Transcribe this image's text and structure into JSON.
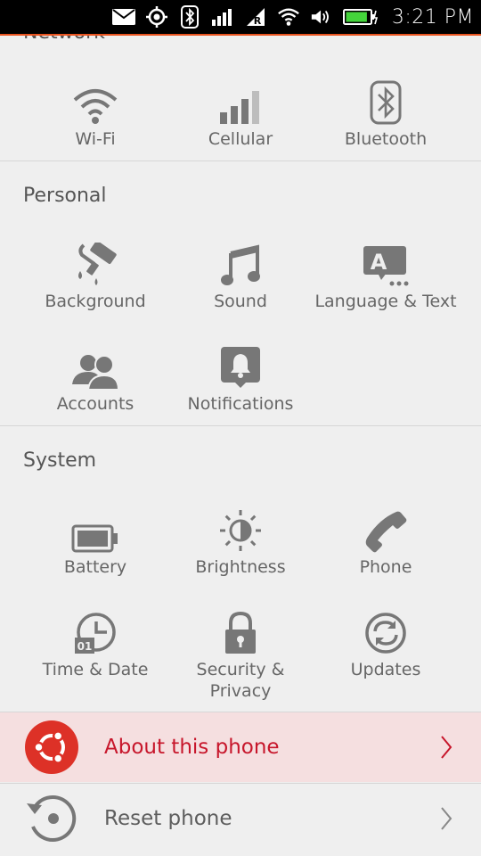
{
  "status_bar": {
    "time": "3:21 PM",
    "network_badge": "R",
    "icons": [
      "mail-icon",
      "location-icon",
      "bluetooth-icon",
      "signal-icon",
      "roaming-icon",
      "wifi-icon",
      "volume-icon",
      "battery-icon"
    ],
    "battery_level": 0.9,
    "battery_color": "#44d43b",
    "accent": "#e95420"
  },
  "sections": {
    "network": {
      "title": "Network",
      "items": [
        {
          "label": "Wi-Fi",
          "icon": "wifi-icon"
        },
        {
          "label": "Cellular",
          "icon": "cellular-signal-icon"
        },
        {
          "label": "Bluetooth",
          "icon": "bluetooth-icon"
        }
      ]
    },
    "personal": {
      "title": "Personal",
      "items": [
        {
          "label": "Background",
          "icon": "paint-roller-icon"
        },
        {
          "label": "Sound",
          "icon": "music-note-icon"
        },
        {
          "label": "Language & Text",
          "icon": "language-text-icon"
        },
        {
          "label": "Accounts",
          "icon": "accounts-icon"
        },
        {
          "label": "Notifications",
          "icon": "notification-bell-icon"
        }
      ]
    },
    "system": {
      "title": "System",
      "items": [
        {
          "label": "Battery",
          "icon": "battery-icon"
        },
        {
          "label": "Brightness",
          "icon": "brightness-icon"
        },
        {
          "label": "Phone",
          "icon": "phone-icon"
        },
        {
          "label": "Time & Date",
          "icon": "clock-icon",
          "badge": "01"
        },
        {
          "label": "Security &\nPrivacy",
          "icon": "lock-icon"
        },
        {
          "label": "Updates",
          "icon": "updates-icon"
        }
      ]
    }
  },
  "list": {
    "about": {
      "label": "About this phone",
      "icon": "ubuntu-logo-icon",
      "active": true
    },
    "reset": {
      "label": "Reset phone",
      "icon": "reset-icon"
    }
  },
  "colors": {
    "background": "#efefef",
    "icon_gray": "#767676",
    "active_row": "#f5dfe0",
    "active_text": "#c7162b",
    "ubuntu_red": "#dd3127"
  }
}
